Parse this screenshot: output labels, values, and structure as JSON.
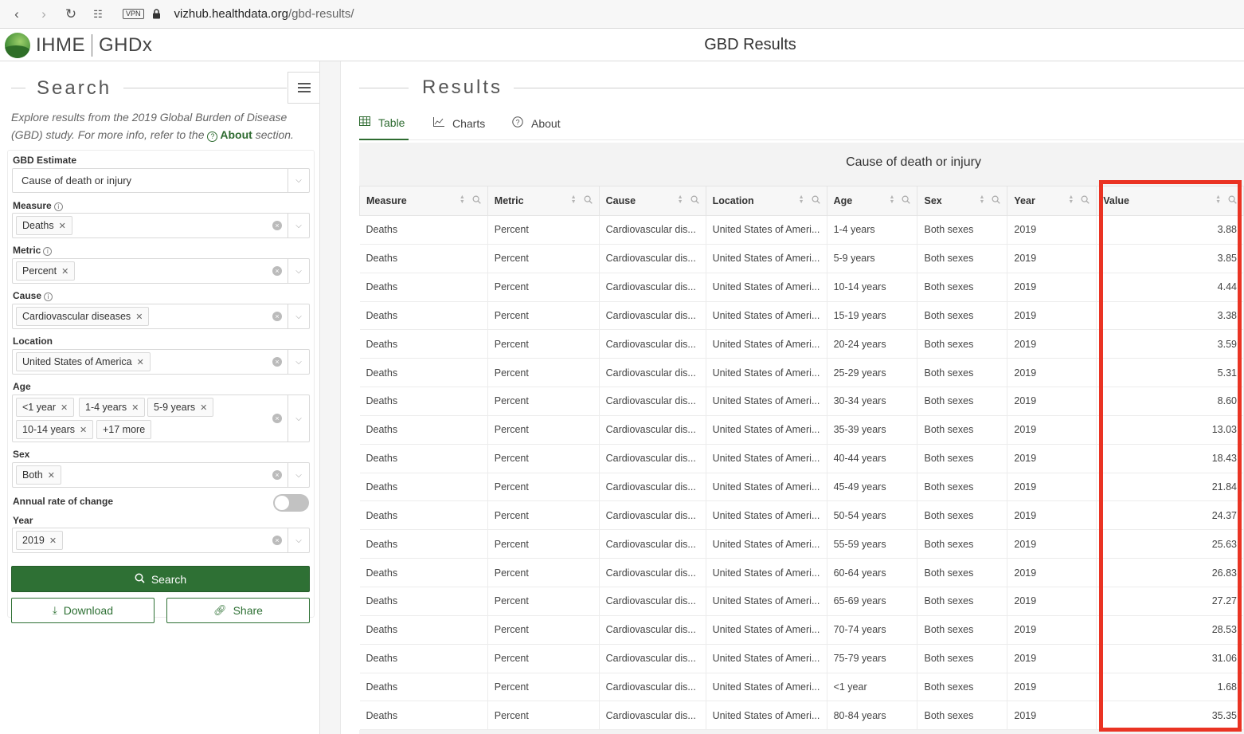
{
  "browser": {
    "vpn_label": "VPN",
    "url_host": "vizhub.healthdata.org",
    "url_path": "/gbd-results/"
  },
  "header": {
    "logo_brand": "IHME",
    "logo_product": "GHDx",
    "title": "GBD Results"
  },
  "sidebar": {
    "heading": "Search",
    "intro_text": "Explore results from the 2019 Global Burden of Disease (GBD) study. For more info, refer to the",
    "intro_link": "About",
    "intro_suffix": "section.",
    "filters": {
      "gbd_estimate": {
        "label": "GBD Estimate",
        "value": "Cause of death or injury"
      },
      "measure": {
        "label": "Measure",
        "tags": [
          "Deaths"
        ]
      },
      "metric": {
        "label": "Metric",
        "tags": [
          "Percent"
        ]
      },
      "cause": {
        "label": "Cause",
        "tags": [
          "Cardiovascular diseases"
        ]
      },
      "location": {
        "label": "Location",
        "tags": [
          "United States of America"
        ]
      },
      "age": {
        "label": "Age",
        "tags": [
          "<1 year",
          "1-4 years",
          "5-9 years",
          "10-14 years"
        ],
        "more": "+17 more"
      },
      "sex": {
        "label": "Sex",
        "tags": [
          "Both"
        ]
      },
      "annual_rate": {
        "label": "Annual rate of change",
        "enabled": false
      },
      "year": {
        "label": "Year",
        "tags": [
          "2019"
        ]
      }
    },
    "buttons": {
      "search": "Search",
      "download": "Download",
      "share": "Share"
    }
  },
  "main": {
    "heading": "Results",
    "tabs": [
      "Table",
      "Charts",
      "About"
    ],
    "active_tab": "Table",
    "table_title": "Cause of death or injury",
    "columns": [
      "Measure",
      "Metric",
      "Cause",
      "Location",
      "Age",
      "Sex",
      "Year",
      "Value"
    ],
    "rows": [
      [
        "Deaths",
        "Percent",
        "Cardiovascular dis...",
        "United States of Ameri...",
        "1-4 years",
        "Both sexes",
        "2019",
        "3.88"
      ],
      [
        "Deaths",
        "Percent",
        "Cardiovascular dis...",
        "United States of Ameri...",
        "5-9 years",
        "Both sexes",
        "2019",
        "3.85"
      ],
      [
        "Deaths",
        "Percent",
        "Cardiovascular dis...",
        "United States of Ameri...",
        "10-14 years",
        "Both sexes",
        "2019",
        "4.44"
      ],
      [
        "Deaths",
        "Percent",
        "Cardiovascular dis...",
        "United States of Ameri...",
        "15-19 years",
        "Both sexes",
        "2019",
        "3.38"
      ],
      [
        "Deaths",
        "Percent",
        "Cardiovascular dis...",
        "United States of Ameri...",
        "20-24 years",
        "Both sexes",
        "2019",
        "3.59"
      ],
      [
        "Deaths",
        "Percent",
        "Cardiovascular dis...",
        "United States of Ameri...",
        "25-29 years",
        "Both sexes",
        "2019",
        "5.31"
      ],
      [
        "Deaths",
        "Percent",
        "Cardiovascular dis...",
        "United States of Ameri...",
        "30-34 years",
        "Both sexes",
        "2019",
        "8.60"
      ],
      [
        "Deaths",
        "Percent",
        "Cardiovascular dis...",
        "United States of Ameri...",
        "35-39 years",
        "Both sexes",
        "2019",
        "13.03"
      ],
      [
        "Deaths",
        "Percent",
        "Cardiovascular dis...",
        "United States of Ameri...",
        "40-44 years",
        "Both sexes",
        "2019",
        "18.43"
      ],
      [
        "Deaths",
        "Percent",
        "Cardiovascular dis...",
        "United States of Ameri...",
        "45-49 years",
        "Both sexes",
        "2019",
        "21.84"
      ],
      [
        "Deaths",
        "Percent",
        "Cardiovascular dis...",
        "United States of Ameri...",
        "50-54 years",
        "Both sexes",
        "2019",
        "24.37"
      ],
      [
        "Deaths",
        "Percent",
        "Cardiovascular dis...",
        "United States of Ameri...",
        "55-59 years",
        "Both sexes",
        "2019",
        "25.63"
      ],
      [
        "Deaths",
        "Percent",
        "Cardiovascular dis...",
        "United States of Ameri...",
        "60-64 years",
        "Both sexes",
        "2019",
        "26.83"
      ],
      [
        "Deaths",
        "Percent",
        "Cardiovascular dis...",
        "United States of Ameri...",
        "65-69 years",
        "Both sexes",
        "2019",
        "27.27"
      ],
      [
        "Deaths",
        "Percent",
        "Cardiovascular dis...",
        "United States of Ameri...",
        "70-74 years",
        "Both sexes",
        "2019",
        "28.53"
      ],
      [
        "Deaths",
        "Percent",
        "Cardiovascular dis...",
        "United States of Ameri...",
        "75-79 years",
        "Both sexes",
        "2019",
        "31.06"
      ],
      [
        "Deaths",
        "Percent",
        "Cardiovascular dis...",
        "United States of Ameri...",
        "<1 year",
        "Both sexes",
        "2019",
        "1.68"
      ],
      [
        "Deaths",
        "Percent",
        "Cardiovascular dis...",
        "United States of Ameri...",
        "80-84 years",
        "Both sexes",
        "2019",
        "35.35"
      ]
    ]
  },
  "colors": {
    "brand_green": "#2e7034",
    "highlight_red": "#ea3323"
  }
}
